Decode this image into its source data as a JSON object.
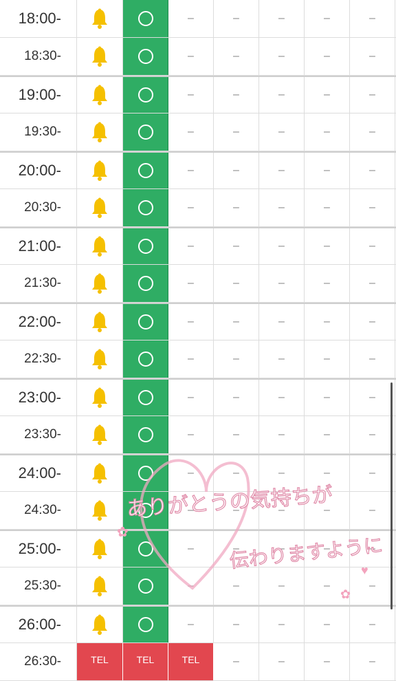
{
  "rows": [
    {
      "time": "18:00-",
      "half": false,
      "slots": [
        "avail",
        "avail",
        "none",
        "none",
        "none",
        "none"
      ]
    },
    {
      "time": "18:30-",
      "half": true,
      "slots": [
        "avail",
        "avail",
        "none",
        "none",
        "none",
        "none"
      ]
    },
    {
      "time": "19:00-",
      "half": false,
      "slots": [
        "avail",
        "avail",
        "none",
        "none",
        "none",
        "none"
      ]
    },
    {
      "time": "19:30-",
      "half": true,
      "slots": [
        "avail",
        "avail",
        "none",
        "none",
        "none",
        "none"
      ]
    },
    {
      "time": "20:00-",
      "half": false,
      "slots": [
        "avail",
        "avail",
        "none",
        "none",
        "none",
        "none"
      ]
    },
    {
      "time": "20:30-",
      "half": true,
      "slots": [
        "avail",
        "avail",
        "none",
        "none",
        "none",
        "none"
      ]
    },
    {
      "time": "21:00-",
      "half": false,
      "slots": [
        "avail",
        "avail",
        "none",
        "none",
        "none",
        "none"
      ]
    },
    {
      "time": "21:30-",
      "half": true,
      "slots": [
        "avail",
        "avail",
        "none",
        "none",
        "none",
        "none"
      ]
    },
    {
      "time": "22:00-",
      "half": false,
      "slots": [
        "avail",
        "avail",
        "none",
        "none",
        "none",
        "none"
      ]
    },
    {
      "time": "22:30-",
      "half": true,
      "slots": [
        "avail",
        "avail",
        "none",
        "none",
        "none",
        "none"
      ]
    },
    {
      "time": "23:00-",
      "half": false,
      "slots": [
        "avail",
        "avail",
        "none",
        "none",
        "none",
        "none"
      ]
    },
    {
      "time": "23:30-",
      "half": true,
      "slots": [
        "avail",
        "avail",
        "none",
        "none",
        "none",
        "none"
      ]
    },
    {
      "time": "24:00-",
      "half": false,
      "slots": [
        "avail",
        "avail",
        "none",
        "none",
        "none",
        "none"
      ]
    },
    {
      "time": "24:30-",
      "half": true,
      "slots": [
        "avail",
        "avail",
        "none",
        "none",
        "none",
        "none"
      ]
    },
    {
      "time": "25:00-",
      "half": false,
      "slots": [
        "avail",
        "avail",
        "none",
        "none",
        "none",
        "none"
      ]
    },
    {
      "time": "25:30-",
      "half": true,
      "slots": [
        "avail",
        "avail",
        "none",
        "none",
        "none",
        "none"
      ]
    },
    {
      "time": "26:00-",
      "half": false,
      "slots": [
        "avail",
        "avail",
        "none",
        "none",
        "none",
        "none"
      ]
    },
    {
      "time": "26:30-",
      "half": true,
      "slots": [
        "tel",
        "tel",
        "tel",
        "none",
        "none",
        "none"
      ]
    }
  ],
  "symbols": {
    "available": "〇",
    "unavailable": "–",
    "tel": "TEL",
    "bell_icon": "bell-icon"
  },
  "colors": {
    "available_bg": "#2fad64",
    "tel_bg": "#e2474f",
    "bell": "#f5c000"
  },
  "stamp": {
    "line1": "ありがとうの気持ちが",
    "line2": "伝わりますように"
  }
}
